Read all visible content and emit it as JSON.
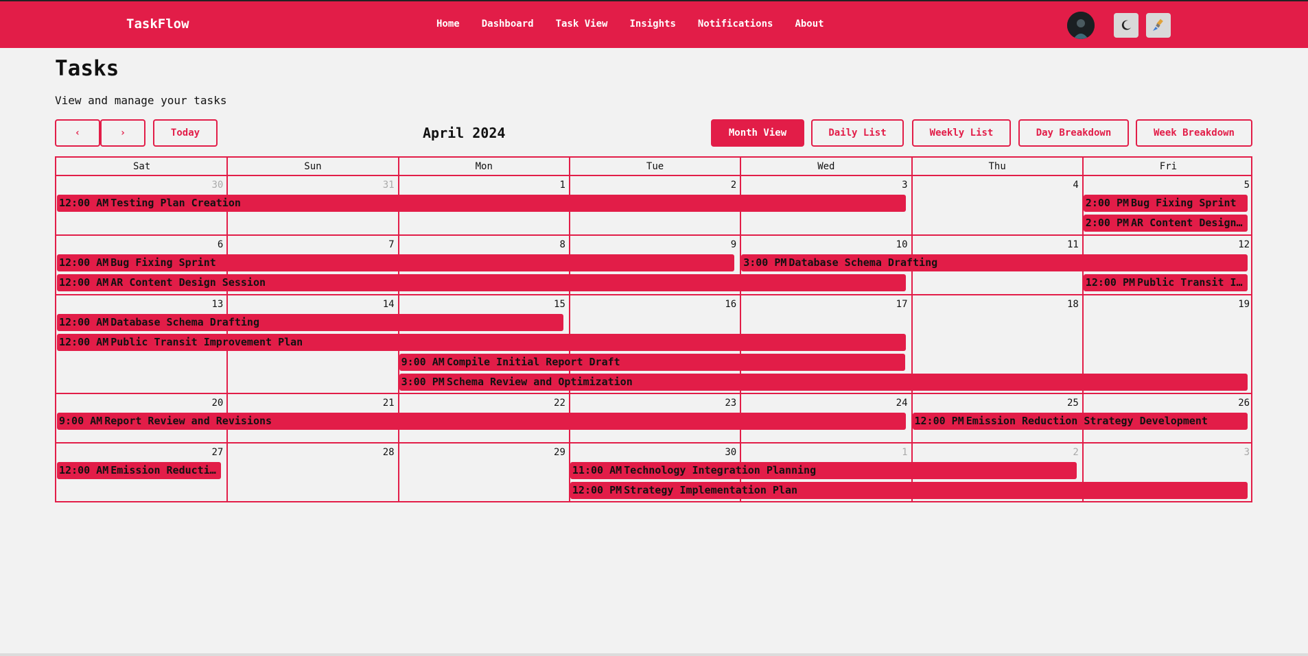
{
  "app": {
    "brand": "TaskFlow",
    "nav": [
      "Home",
      "Dashboard",
      "Task View",
      "Insights",
      "Notifications",
      "About"
    ]
  },
  "header": {
    "theme_icon": "moon-icon",
    "tools_icon": "paintbrush-icon"
  },
  "page": {
    "title": "Tasks",
    "subtitle": "View and manage your tasks"
  },
  "calendar_controls": {
    "prev_label": "‹",
    "next_label": "›",
    "today_label": "Today",
    "month_label": "April 2024",
    "views": [
      "Month View",
      "Daily List",
      "Weekly List",
      "Day Breakdown",
      "Week Breakdown"
    ],
    "active_view": "Month View"
  },
  "calendar": {
    "weekdays": [
      "Sat",
      "Sun",
      "Mon",
      "Tue",
      "Wed",
      "Thu",
      "Fri"
    ],
    "weeks": [
      [
        {
          "d": "30",
          "muted": true
        },
        {
          "d": "31",
          "muted": true
        },
        {
          "d": "1"
        },
        {
          "d": "2"
        },
        {
          "d": "3"
        },
        {
          "d": "4"
        },
        {
          "d": "5"
        }
      ],
      [
        {
          "d": "6"
        },
        {
          "d": "7"
        },
        {
          "d": "8"
        },
        {
          "d": "9"
        },
        {
          "d": "10"
        },
        {
          "d": "11"
        },
        {
          "d": "12"
        }
      ],
      [
        {
          "d": "13"
        },
        {
          "d": "14"
        },
        {
          "d": "15"
        },
        {
          "d": "16"
        },
        {
          "d": "17"
        },
        {
          "d": "18"
        },
        {
          "d": "19"
        }
      ],
      [
        {
          "d": "20"
        },
        {
          "d": "21"
        },
        {
          "d": "22"
        },
        {
          "d": "23"
        },
        {
          "d": "24"
        },
        {
          "d": "25"
        },
        {
          "d": "26"
        }
      ],
      [
        {
          "d": "27"
        },
        {
          "d": "28"
        },
        {
          "d": "29"
        },
        {
          "d": "30"
        },
        {
          "d": "1",
          "muted": true
        },
        {
          "d": "2",
          "muted": true
        },
        {
          "d": "3",
          "muted": true
        }
      ]
    ],
    "events": [
      {
        "week": 0,
        "start": 0,
        "span": 5,
        "lane": 0,
        "time": "12:00 AM",
        "title": "Testing Plan Creation"
      },
      {
        "week": 0,
        "start": 6,
        "span": 1,
        "lane": 0,
        "time": "2:00 PM",
        "title": "Bug Fixing Sprint"
      },
      {
        "week": 0,
        "start": 6,
        "span": 1,
        "lane": 1,
        "time": "2:00 PM",
        "title": "AR Content Design Session"
      },
      {
        "week": 1,
        "start": 0,
        "span": 4,
        "lane": 0,
        "time": "12:00 AM",
        "title": "Bug Fixing Sprint"
      },
      {
        "week": 1,
        "start": 4,
        "span": 3,
        "lane": 0,
        "time": "3:00 PM",
        "title": "Database Schema Drafting"
      },
      {
        "week": 1,
        "start": 0,
        "span": 5,
        "lane": 1,
        "time": "12:00 AM",
        "title": "AR Content Design Session"
      },
      {
        "week": 1,
        "start": 6,
        "span": 1,
        "lane": 1,
        "time": "12:00 PM",
        "title": "Public Transit Improvement Plan"
      },
      {
        "week": 2,
        "start": 0,
        "span": 3,
        "lane": 0,
        "time": "12:00 AM",
        "title": "Database Schema Drafting"
      },
      {
        "week": 2,
        "start": 0,
        "span": 5,
        "lane": 1,
        "time": "12:00 AM",
        "title": "Public Transit Improvement Plan"
      },
      {
        "week": 2,
        "start": 2,
        "span": 3,
        "lane": 2,
        "time": "9:00 AM",
        "title": "Compile Initial Report Draft"
      },
      {
        "week": 2,
        "start": 2,
        "span": 5,
        "lane": 3,
        "time": "3:00 PM",
        "title": "Schema Review and Optimization"
      },
      {
        "week": 3,
        "start": 0,
        "span": 5,
        "lane": 0,
        "time": "9:00 AM",
        "title": "Report Review and Revisions"
      },
      {
        "week": 3,
        "start": 5,
        "span": 2,
        "lane": 0,
        "time": "12:00 PM",
        "title": "Emission Reduction Strategy Development"
      },
      {
        "week": 4,
        "start": 0,
        "span": 1,
        "lane": 0,
        "time": "12:00 AM",
        "title": "Emission Reduction Strategy Development"
      },
      {
        "week": 4,
        "start": 3,
        "span": 3,
        "lane": 0,
        "time": "11:00 AM",
        "title": "Technology Integration Planning"
      },
      {
        "week": 4,
        "start": 3,
        "span": 4,
        "lane": 1,
        "time": "12:00 PM",
        "title": "Strategy Implementation Plan"
      }
    ]
  }
}
